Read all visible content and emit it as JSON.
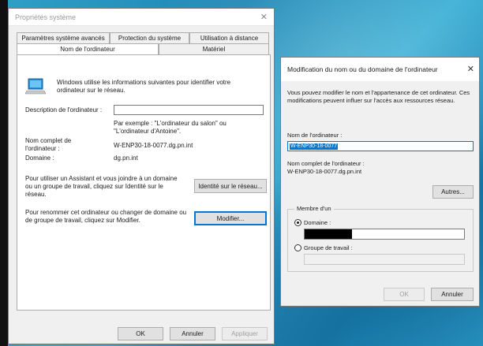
{
  "system_dialog": {
    "title": "Propriétés système",
    "close_glyph": "✕",
    "tabs_row1": [
      "Paramètres système avancés",
      "Protection du système",
      "Utilisation à distance"
    ],
    "tabs_row2": [
      "Nom de l'ordinateur",
      "Matériel"
    ],
    "selected_tab": "Nom de l'ordinateur",
    "intro_text": "Windows utilise les informations suivantes pour identifier votre ordinateur sur le réseau.",
    "description_label": "Description de l'ordinateur :",
    "description_value": "",
    "example_text": "Par exemple : \"L'ordinateur du salon\" ou \"L'ordinateur d'Antoine\".",
    "fullname_label": "Nom complet de l'ordinateur :",
    "fullname_value": "W-ENP30-18-0077.dg.pn.int",
    "domain_label": "Domaine :",
    "domain_value": "dg.pn.int",
    "wizard_text": "Pour utiliser un Assistant et vous joindre à un domaine ou un groupe de travail, cliquez sur Identité sur le réseau.",
    "network_id_button": "Identité sur le réseau...",
    "rename_text": "Pour renommer cet ordinateur ou changer de domaine ou de groupe de travail, cliquez sur Modifier.",
    "modify_button": "Modifier...",
    "ok_button": "OK",
    "cancel_button": "Annuler",
    "apply_button": "Appliquer"
  },
  "rename_dialog": {
    "title": "Modification du nom ou du domaine de l'ordinateur",
    "close_glyph": "✕",
    "intro_text": "Vous pouvez modifier le nom et l'appartenance de cet ordinateur. Ces modifications peuvent influer sur l'accès aux ressources réseau.",
    "name_label": "Nom de l'ordinateur :",
    "name_value": "W-ENP30-18-0077",
    "fullname_label": "Nom complet de l'ordinateur :",
    "fullname_value": "W-ENP30-18-0077.dg.pn.int",
    "more_button": "Autres...",
    "member_legend": "Membre d'un",
    "domain_radio_label": "Domaine :",
    "domain_selected": true,
    "workgroup_radio_label": "Groupe de travail :",
    "workgroup_value": "",
    "ok_button": "OK",
    "cancel_button": "Annuler"
  },
  "colors": {
    "accent": "#0078d7",
    "dialog_bg": "#f0f0f0",
    "desktop": "#2a9ac6"
  }
}
